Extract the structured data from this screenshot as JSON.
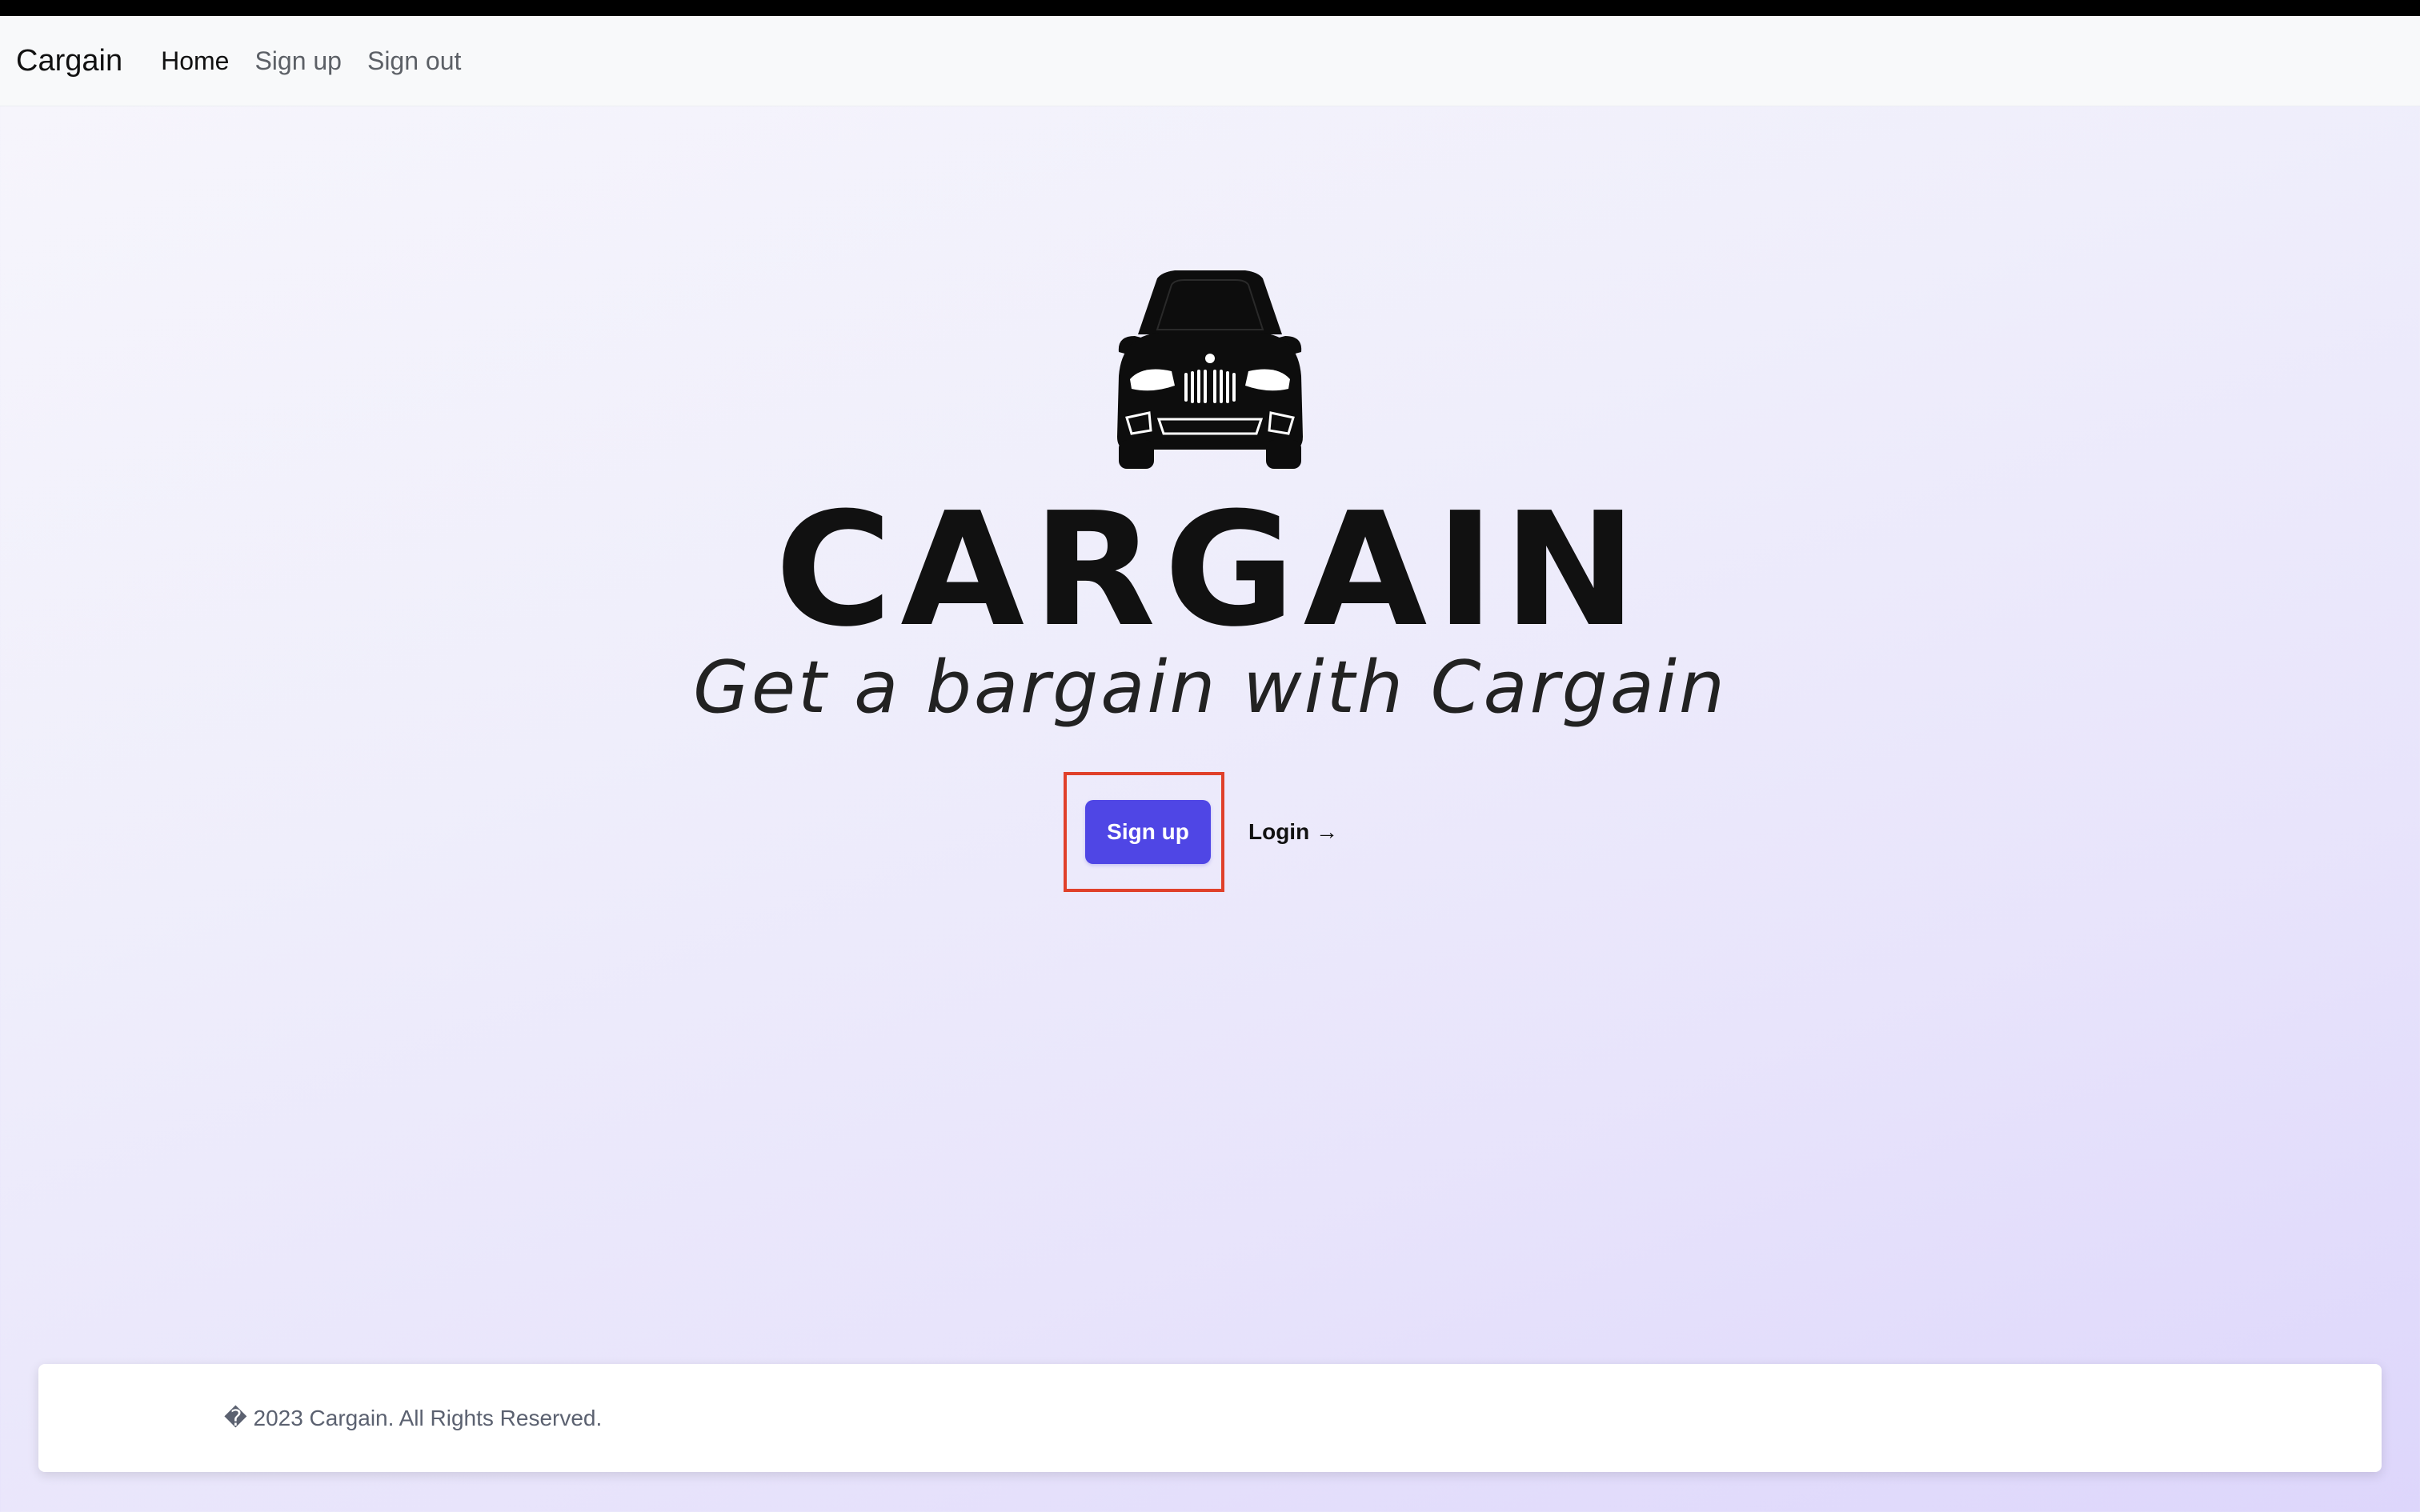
{
  "navbar": {
    "brand": "Cargain",
    "links": [
      {
        "label": "Home",
        "active": true
      },
      {
        "label": "Sign up",
        "active": false
      },
      {
        "label": "Sign out",
        "active": false
      }
    ]
  },
  "hero": {
    "logo_icon": "car-front-icon",
    "wordmark": "CARGAIN",
    "tagline": "Get a bargain with Cargain",
    "signup_label": "Sign up",
    "login_label": "Login →"
  },
  "footer": {
    "text": "� 2023 Cargain. All Rights Reserved."
  },
  "colors": {
    "accent": "#4f46e5",
    "highlight": "#e0402a",
    "navbar_bg": "#f8f9fa"
  }
}
